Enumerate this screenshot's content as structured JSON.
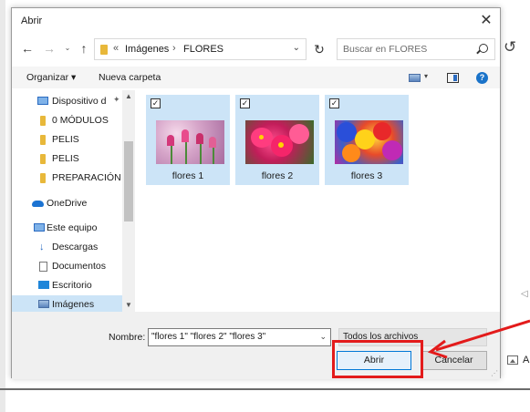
{
  "dialog": {
    "title": "Abrir",
    "close_glyph": "✕"
  },
  "navbar": {
    "back_glyph": "←",
    "forward_glyph": "→",
    "recent_glyph": "⌄",
    "up_glyph": "↑",
    "breadcrumb": {
      "overflow": "«",
      "items": [
        "Imágenes",
        "FLORES"
      ],
      "separator": "›"
    },
    "address_dropdown_glyph": "⌄",
    "refresh_glyph": "↻",
    "search_placeholder": "Buscar en FLORES"
  },
  "toolbar": {
    "organize_label": "Organizar ▾",
    "new_folder_label": "Nueva carpeta",
    "view_dropdown_glyph": "▾",
    "help_label": "?"
  },
  "sidebar": {
    "items": [
      {
        "label": "Dispositivo d",
        "icon": "device-icon",
        "pinned": true
      },
      {
        "label": "0 MÓDULOS",
        "icon": "folder-icon"
      },
      {
        "label": "PELIS",
        "icon": "folder-icon"
      },
      {
        "label": "PELIS",
        "icon": "folder-icon"
      },
      {
        "label": "PREPARACIÓN E",
        "icon": "folder-icon"
      },
      {
        "label": "OneDrive",
        "icon": "onedrive-icon"
      },
      {
        "label": "Este equipo",
        "icon": "pc-icon"
      },
      {
        "label": "Descargas",
        "icon": "download-icon"
      },
      {
        "label": "Documentos",
        "icon": "document-icon"
      },
      {
        "label": "Escritorio",
        "icon": "desktop-icon"
      },
      {
        "label": "Imágenes",
        "icon": "pictures-icon",
        "selected": true
      },
      {
        "label": "",
        "icon": "network-icon"
      }
    ],
    "pin_glyph": "✦",
    "scroll_up_glyph": "▲",
    "scroll_down_glyph": "▼"
  },
  "files": [
    {
      "name": "flores 1",
      "checked": true
    },
    {
      "name": "flores 2",
      "checked": true
    },
    {
      "name": "flores 3",
      "checked": true
    }
  ],
  "check_glyph": "✓",
  "bottom": {
    "name_label": "Nombre:",
    "name_value": "\"flores 1\" \"flores 2\" \"flores 3\"",
    "name_drop_glyph": "⌄",
    "filetype_value": "Todos los archivos",
    "open_label": "Abrir",
    "cancel_label": "Cancelar",
    "resize_glyph": "⋰"
  },
  "background": {
    "undo_glyph": "↺",
    "left_arrow_glyph": "◁",
    "text_fragment": "A"
  },
  "colors": {
    "accent": "#0078d7",
    "selection": "#cce4f7",
    "annotation": "#e31b1b"
  }
}
